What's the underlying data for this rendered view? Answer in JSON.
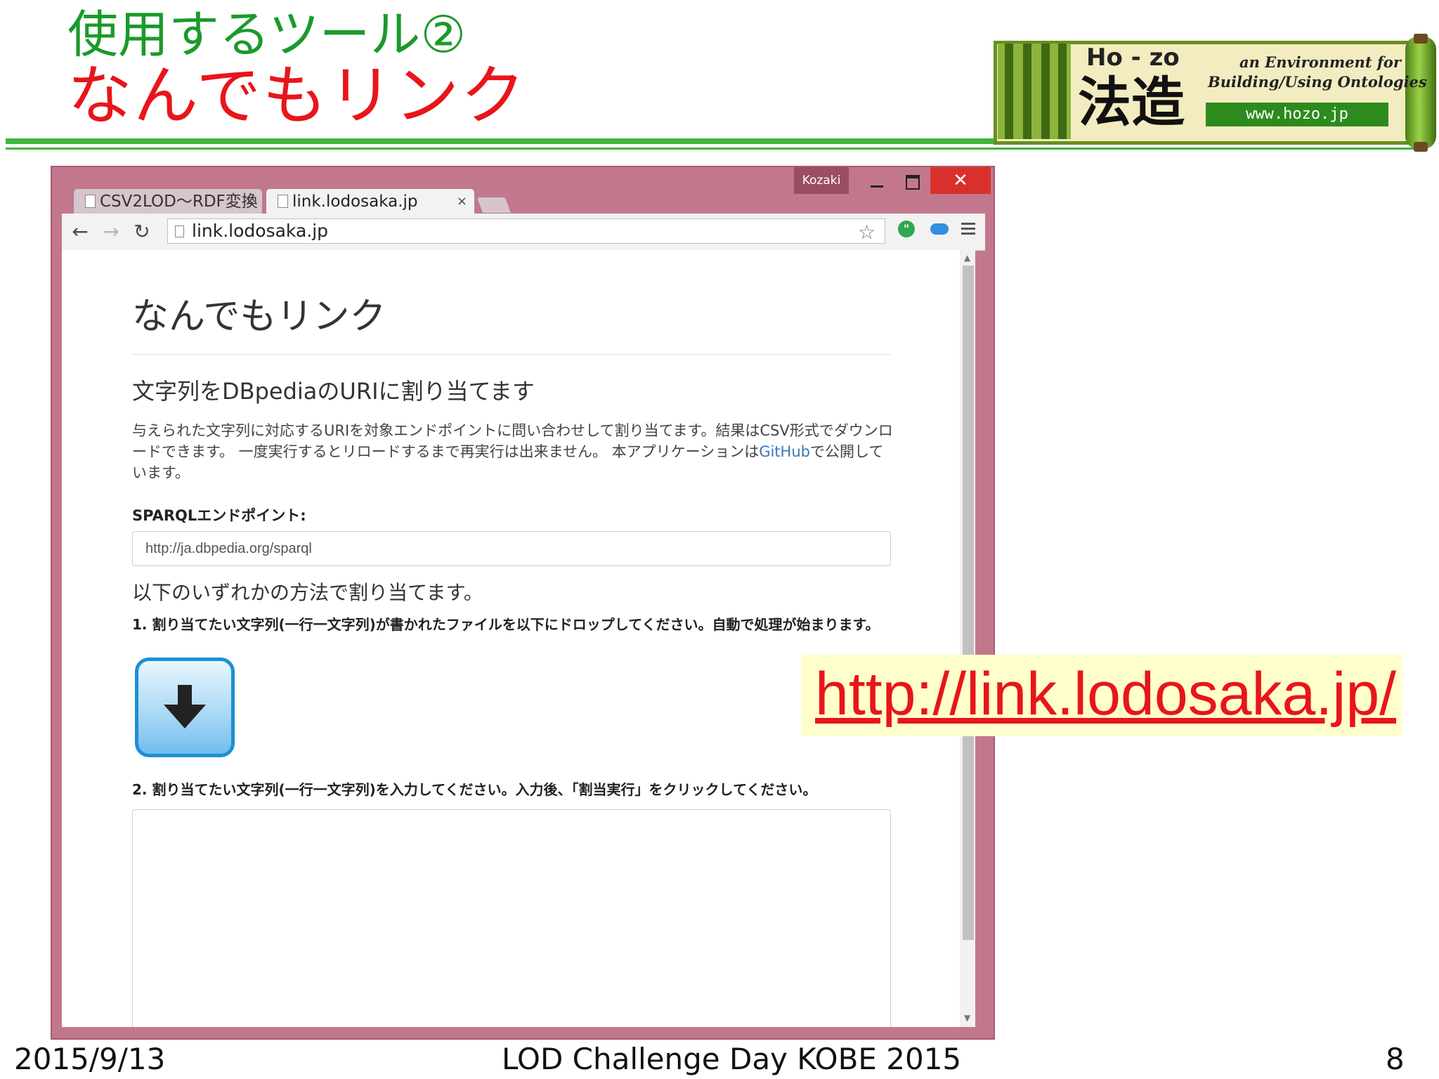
{
  "slide": {
    "title_line1": "使用するツール②",
    "title_line2": "なんでもリンク",
    "footer_date": "2015/9/13",
    "footer_event": "LOD Challenge Day KOBE 2015",
    "page_number": "8",
    "url_callout": "http://link.lodosaka.jp/"
  },
  "logo": {
    "latin": "Ho - zo",
    "kanji": "法造",
    "tagline1": "an Environment for",
    "tagline2": "Building/Using Ontologies",
    "url": "www.hozo.jp"
  },
  "browser": {
    "user": "Kozaki",
    "tabs": [
      {
        "label": "CSV2LOD〜RDF変換",
        "active": false
      },
      {
        "label": "link.lodosaka.jp",
        "active": true
      }
    ],
    "address": "link.lodosaka.jp",
    "close_glyph": "×"
  },
  "page": {
    "heading": "なんでもリンク",
    "subheading": "文字列をDBpediaのURIに割り当てます",
    "description_part1": "与えられた文字列に対応するURIを対象エンドポイントに問い合わせして割り当てます。結果はCSV形式でダウンロードできます。 一度実行するとリロードするまで再実行は出来ません。 本アプリケーションは",
    "description_link": "GitHub",
    "description_part2": "で公開しています。",
    "endpoint_label": "SPARQLエンドポイント:",
    "endpoint_value": "http://ja.dbpedia.org/sparql",
    "methods_heading": "以下のいずれかの方法で割り当てます。",
    "step1": "1. 割り当てたい文字列(一行一文字列)が書かれたファイルを以下にドロップしてください。自動で処理が始まります。",
    "step2": "2. 割り当てたい文字列(一行一文字列)を入力してください。入力後、「割当実行」をクリックしてください。"
  },
  "colors": {
    "title_green": "#1a9a2a",
    "title_red": "#e8151a",
    "window_frame": "#c3778d",
    "close_red": "#d9302c",
    "link_blue": "#3a7ab8"
  },
  "icons": [
    "back-icon",
    "forward-icon",
    "reload-icon",
    "page-icon",
    "star-icon",
    "hangouts-icon",
    "cloud-icon",
    "menu-icon",
    "download-arrow-icon",
    "close-icon",
    "minimize-icon",
    "maximize-icon"
  ]
}
